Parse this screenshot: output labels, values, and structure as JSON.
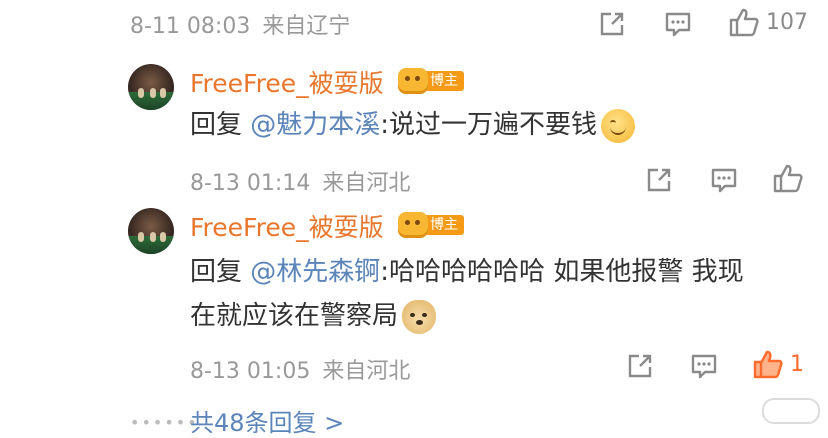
{
  "top_row": {
    "time": "8-11 08:03",
    "source": "来自辽宁",
    "like_count": "107"
  },
  "replies": [
    {
      "username": "FreeFree_被耍版",
      "badge_label": "博主",
      "reply_prefix": "回复",
      "mention": "@魅力本溪",
      "text": ":说过一万遍不要钱",
      "emoji": "smile-emoji",
      "time": "8-13 01:14",
      "source": "来自河北",
      "like_count": ""
    },
    {
      "username": "FreeFree_被耍版",
      "badge_label": "博主",
      "reply_prefix": "回复",
      "mention": "@林先森锕",
      "text_line1": ":哈哈哈哈哈哈 如果他报警 我现",
      "text_line2": "在就应该在警察局",
      "emoji": "doge-emoji",
      "time": "8-13 01:05",
      "source": "来自河北",
      "like_count": "1",
      "liked": true
    }
  ],
  "more_replies": "共48条回复 >",
  "colors": {
    "username": "#e8762d",
    "mention": "#5b84b9",
    "meta": "#999999",
    "liked": "#ff6b2c"
  },
  "icons": [
    "share-icon",
    "comment-icon",
    "like-icon"
  ]
}
